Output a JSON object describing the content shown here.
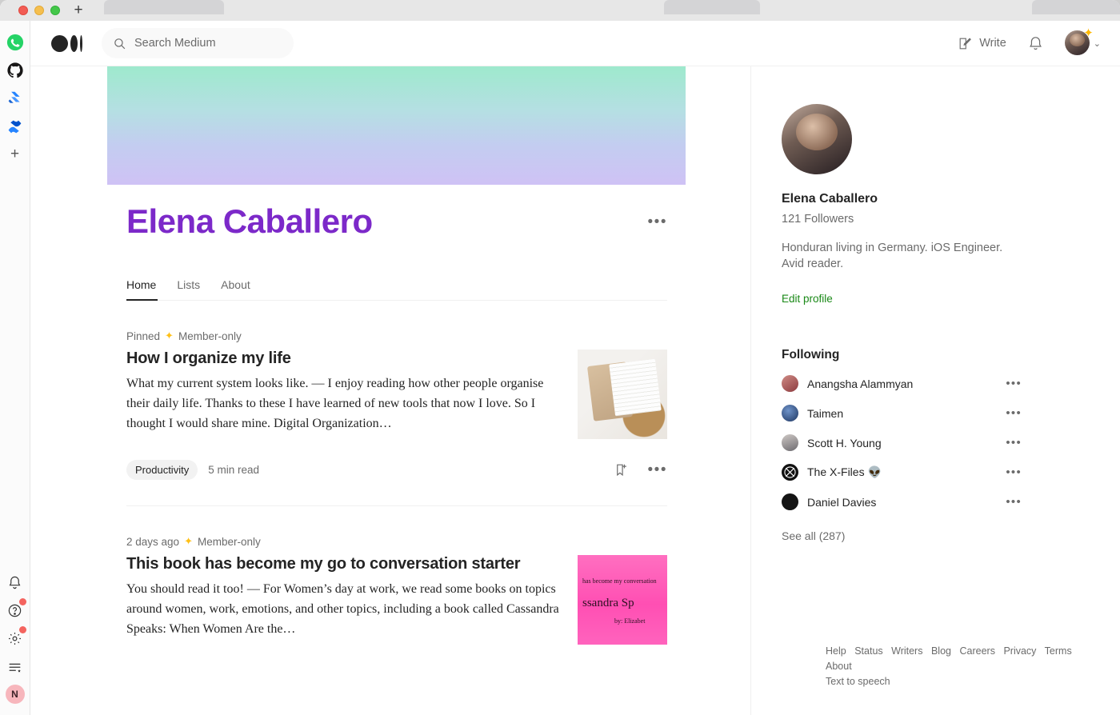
{
  "window": {
    "traffic_lights": [
      "close",
      "minimize",
      "maximize"
    ],
    "new_tab_label": "+"
  },
  "rail": {
    "apps": [
      {
        "name": "whatsapp-icon",
        "label": "WhatsApp",
        "badge": false
      },
      {
        "name": "github-icon",
        "label": "GitHub",
        "badge": false
      },
      {
        "name": "jira-icon",
        "label": "Jira",
        "badge": false
      },
      {
        "name": "confluence-icon",
        "label": "Confluence",
        "badge": false
      },
      {
        "name": "add-app-icon",
        "label": "+",
        "badge": false
      }
    ],
    "bottom": [
      {
        "name": "bell-icon",
        "label": "Notifications",
        "badge": false
      },
      {
        "name": "help-icon",
        "label": "Help",
        "badge": true
      },
      {
        "name": "gear-icon",
        "label": "Settings",
        "badge": true
      },
      {
        "name": "list-icon",
        "label": "Menu",
        "badge": false
      }
    ],
    "avatar_initial": "N"
  },
  "header": {
    "logo_name": "medium-logo",
    "search": {
      "placeholder": "Search Medium",
      "value": ""
    },
    "write_label": "Write",
    "notification_name": "bell-icon",
    "avatar_name": "user-avatar",
    "chevron": "⌄"
  },
  "profile": {
    "display_name": "Elena Caballero",
    "name_color": "#7c29c9",
    "banner_gradient": [
      "#9ee9cd",
      "#c3cdf0",
      "#cfc2f5"
    ],
    "more_dots": "•••",
    "tabs": [
      {
        "label": "Home",
        "active": true
      },
      {
        "label": "Lists",
        "active": false
      },
      {
        "label": "About",
        "active": false
      }
    ]
  },
  "articles": [
    {
      "meta_prefix": "Pinned",
      "member_label": "Member-only",
      "title": "How I organize my life",
      "snippet": "What my current system looks like. — I enjoy reading how other people organise their daily life. Thanks to these I have learned of new tools that now I love. So I thought I would share mine. Digital Organization…",
      "tag": "Productivity",
      "read_time": "5 min read",
      "thumbnail_alt": "planner-notebook-with-pen",
      "save_icon": "bookmark-add-icon",
      "more_icon": "more-options-icon"
    },
    {
      "meta_prefix": "2 days ago",
      "member_label": "Member-only",
      "title": "This book has become my go to conversation starter",
      "snippet": "You should read it too! — For Women’s day at work, we read some books on topics around women, work, emotions, and other topics, including a book called Cassandra Speaks: When Women Are the…",
      "tag": "",
      "read_time": "",
      "thumbnail_alt": "pink-book-cover-cassandra-speaks",
      "thumbnail_lines": [
        "has become my conversation",
        "ssandra Sp",
        "by: Elizabet"
      ],
      "save_icon": "bookmark-add-icon",
      "more_icon": "more-options-icon"
    }
  ],
  "sidebar": {
    "name": "Elena Caballero",
    "followers": "121 Followers",
    "bio": "Honduran living in Germany. iOS Engineer. Avid reader.",
    "edit_profile": "Edit profile",
    "edit_profile_color": "#1a8917",
    "following_title": "Following",
    "following": [
      {
        "name": "Anangsha Alammyan",
        "avatar_color": "#b4484f",
        "dots": "•••"
      },
      {
        "name": "Taimen",
        "avatar_color": "#2c4f86",
        "dots": "•••"
      },
      {
        "name": "Scott H. Young",
        "avatar_color": "#9c9aa0",
        "dots": "•••"
      },
      {
        "name": "The X-Files 👽",
        "avatar_color": "#111111",
        "dots": "•••"
      },
      {
        "name": "Daniel Davies",
        "avatar_color": "#151515",
        "dots": "•••"
      }
    ],
    "see_all": "See all (287)"
  },
  "footer": {
    "links": [
      "Help",
      "Status",
      "Writers",
      "Blog",
      "Careers",
      "Privacy",
      "Terms",
      "About"
    ],
    "secondary": "Text to speech"
  }
}
